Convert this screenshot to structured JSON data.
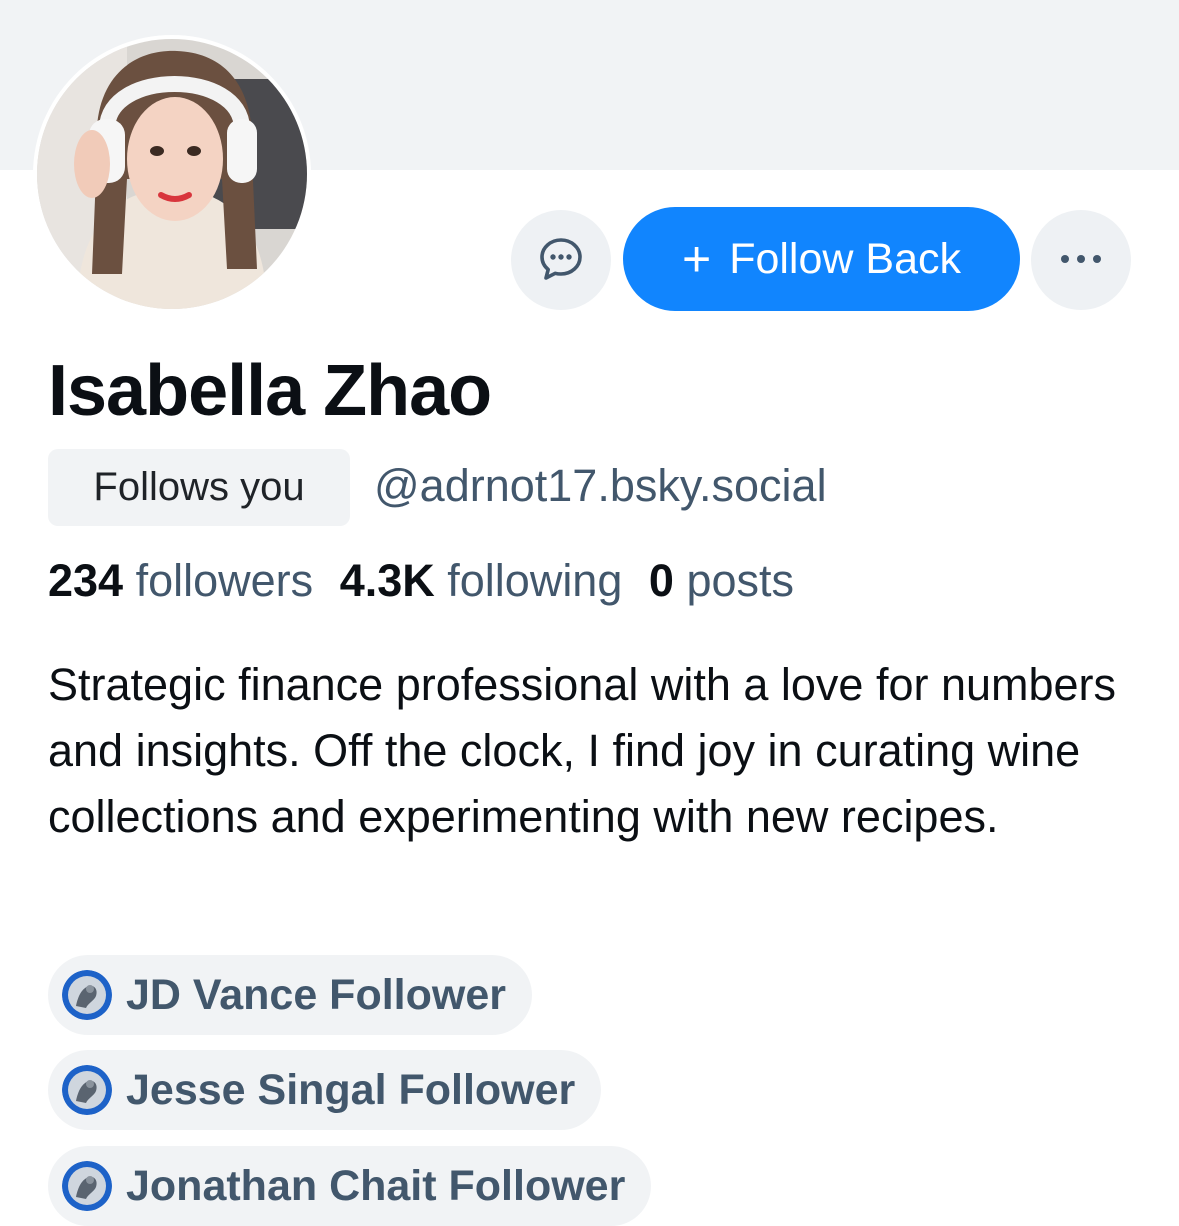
{
  "profile": {
    "display_name": "Isabella Zhao",
    "follows_you_label": "Follows you",
    "handle": "@adrnot17.bsky.social",
    "bio": "Strategic finance professional with a love for numbers and insights. Off the clock, I find joy in curating wine collections and experimenting with new recipes."
  },
  "actions": {
    "message_icon": "chat-bubble-icon",
    "follow_plus": "+",
    "follow_label": "Follow Back",
    "more_icon": "more-horizontal-icon"
  },
  "stats": {
    "followers_count": "234",
    "followers_label": "followers",
    "following_count": "4.3K",
    "following_label": "following",
    "posts_count": "0",
    "posts_label": "posts"
  },
  "labels": [
    {
      "text": "JD Vance Follower"
    },
    {
      "text": "Jesse Singal Follower"
    },
    {
      "text": "Jonathan Chait Follower"
    }
  ],
  "colors": {
    "accent": "#1185fe",
    "banner": "#f1f3f5",
    "secondary_text": "#42576c"
  }
}
